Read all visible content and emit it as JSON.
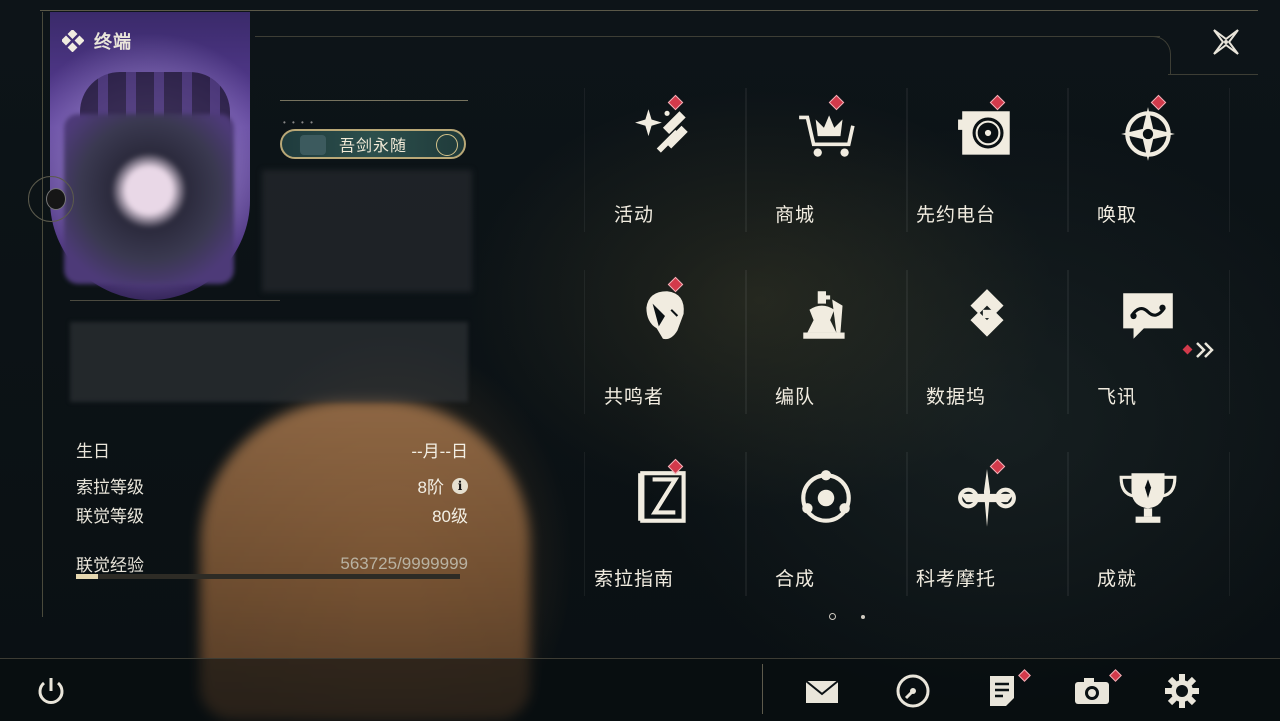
{
  "header": {
    "title": "终端"
  },
  "profile": {
    "badge_label": "吾剑永随",
    "stats": [
      {
        "label": "生日",
        "value": "--月--日"
      },
      {
        "label": "索拉等级",
        "value": "8阶"
      },
      {
        "label": "联觉等级",
        "value": "80级"
      }
    ],
    "exp": {
      "label": "联觉经验",
      "value": "563725/9999999",
      "progress": 0.056
    }
  },
  "menu": {
    "items": [
      {
        "label": "活动",
        "icon": "sparkle-icon",
        "notify": true
      },
      {
        "label": "商城",
        "icon": "cart-crown-icon",
        "notify": true
      },
      {
        "label": "先约电台",
        "icon": "radio-icon",
        "notify": true
      },
      {
        "label": "唤取",
        "icon": "compass-star-icon",
        "notify": true
      },
      {
        "label": "共鸣者",
        "icon": "character-head-icon",
        "notify": true
      },
      {
        "label": "编队",
        "icon": "chess-icon",
        "notify": false
      },
      {
        "label": "数据坞",
        "icon": "data-dock-icon",
        "notify": false
      },
      {
        "label": "飞讯",
        "icon": "chat-bubble-icon",
        "notify": false
      },
      {
        "label": "索拉指南",
        "icon": "guide-book-icon",
        "notify": true
      },
      {
        "label": "合成",
        "icon": "synthesis-icon",
        "notify": false
      },
      {
        "label": "科考摩托",
        "icon": "motorbike-icon",
        "notify": true
      },
      {
        "label": "成就",
        "icon": "trophy-icon",
        "notify": false
      }
    ],
    "page": {
      "current": 1,
      "total": 2
    }
  },
  "bottom": {
    "icons": [
      "power-icon",
      "mail-icon",
      "clock-icon",
      "notes-icon",
      "camera-icon",
      "settings-icon"
    ]
  },
  "colors": {
    "accent": "#d23a4b",
    "text": "#f1ece0",
    "background": "#0b1114"
  }
}
